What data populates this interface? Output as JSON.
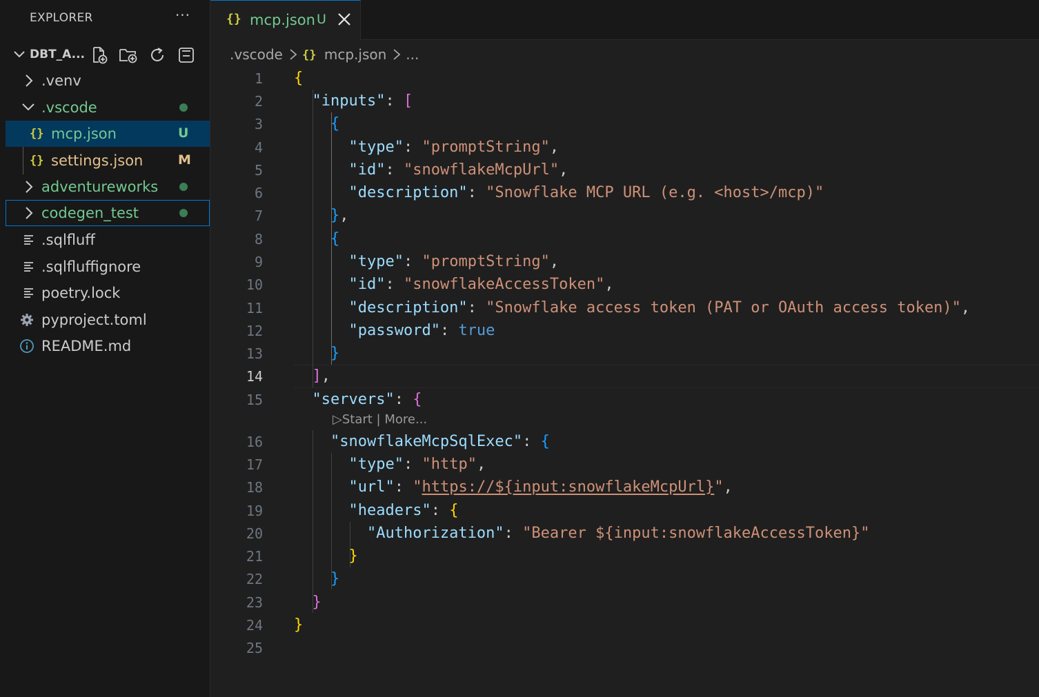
{
  "explorer": {
    "title": "EXPLORER",
    "more": "···",
    "root": "DBT_A...",
    "items": [
      {
        "label": ".venv"
      },
      {
        "label": ".vscode",
        "status": "dot"
      },
      {
        "label": "mcp.json",
        "badge": "U"
      },
      {
        "label": "settings.json",
        "badge": "M"
      },
      {
        "label": "adventureworks",
        "status": "dot"
      },
      {
        "label": "codegen_test",
        "status": "dot"
      },
      {
        "label": ".sqlfluff"
      },
      {
        "label": ".sqlfluffignore"
      },
      {
        "label": "poetry.lock"
      },
      {
        "label": "pyproject.toml"
      },
      {
        "label": "README.md"
      }
    ]
  },
  "tab": {
    "name": "mcp.json",
    "badge": "U"
  },
  "breadcrumb": {
    "folder": ".vscode",
    "file": "mcp.json",
    "tail": "..."
  },
  "editor": {
    "line_numbers": [
      "1",
      "2",
      "3",
      "4",
      "5",
      "6",
      "7",
      "8",
      "9",
      "10",
      "11",
      "12",
      "13",
      "14",
      "15",
      "16",
      "17",
      "18",
      "19",
      "20",
      "21",
      "22",
      "23",
      "24",
      "25"
    ],
    "active_line": "14",
    "codelens": "▷Start | More...",
    "lines": {
      "l1": {
        "b": "{"
      },
      "l2": {
        "k": "\"inputs\"",
        "p": ": ",
        "b": "["
      },
      "l3": {
        "b": "{"
      },
      "l4": {
        "k": "\"type\"",
        "p": ": ",
        "s": "\"promptString\"",
        "e": ","
      },
      "l5": {
        "k": "\"id\"",
        "p": ": ",
        "s": "\"snowflakeMcpUrl\"",
        "e": ","
      },
      "l6": {
        "k": "\"description\"",
        "p": ": ",
        "s": "\"Snowflake MCP URL (e.g. <host>/mcp)\""
      },
      "l7": {
        "b": "}",
        "e": ","
      },
      "l8": {
        "b": "{"
      },
      "l9": {
        "k": "\"type\"",
        "p": ": ",
        "s": "\"promptString\"",
        "e": ","
      },
      "l10": {
        "k": "\"id\"",
        "p": ": ",
        "s": "\"snowflakeAccessToken\"",
        "e": ","
      },
      "l11": {
        "k": "\"description\"",
        "p": ": ",
        "s": "\"Snowflake access token (PAT or OAuth access token)\"",
        "e": ","
      },
      "l12": {
        "k": "\"password\"",
        "p": ": ",
        "v": "true"
      },
      "l13": {
        "b": "}"
      },
      "l14": {
        "b": "]",
        "e": ","
      },
      "l15": {
        "k": "\"servers\"",
        "p": ": ",
        "b": "{"
      },
      "l16": {
        "k": "\"snowflakeMcpSqlExec\"",
        "p": ": ",
        "b": "{"
      },
      "l17": {
        "k": "\"type\"",
        "p": ": ",
        "s": "\"http\"",
        "e": ","
      },
      "l18": {
        "k": "\"url\"",
        "p": ": ",
        "q": "\"",
        "s": "https://${input:snowflakeMcpUrl}",
        "q2": "\"",
        "e": ","
      },
      "l19": {
        "k": "\"headers\"",
        "p": ": ",
        "b": "{"
      },
      "l20": {
        "k": "\"Authorization\"",
        "p": ": ",
        "s": "\"Bearer ${input:snowflakeAccessToken}\""
      },
      "l21": {
        "b": "}"
      },
      "l22": {
        "b": "}"
      },
      "l23": {
        "b": "}"
      },
      "l24": {
        "b": "}"
      }
    }
  },
  "colors": {
    "accent": "#0078d4",
    "untracked": "#73c991",
    "modified": "#e2c08d",
    "string": "#ce9178",
    "key": "#9cdcfe"
  }
}
